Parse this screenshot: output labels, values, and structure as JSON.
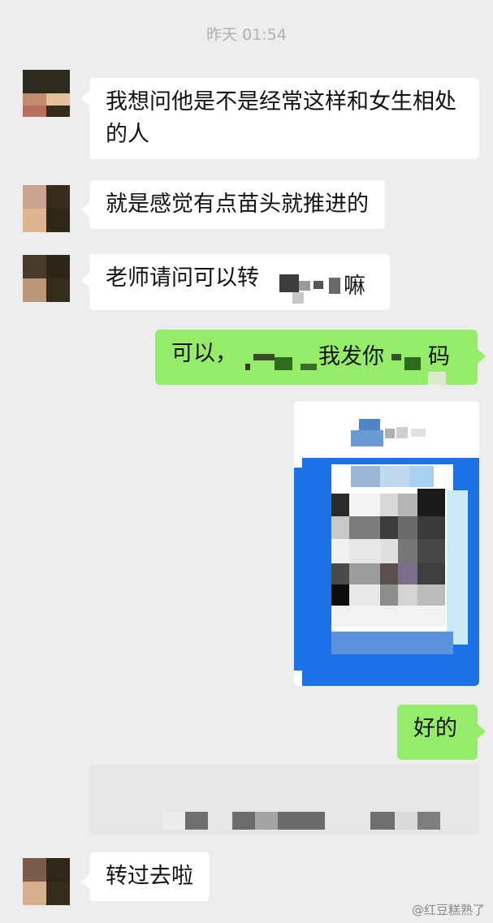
{
  "chat": {
    "timestamp": "昨天 01:54",
    "messages": [
      {
        "side": "in",
        "text": "我想问他是不是经常这样和女生相处的人"
      },
      {
        "side": "in",
        "text": "就是感觉有点苗头就推进的"
      },
      {
        "side": "in",
        "text_before": "老师请问可以转",
        "text_after": "嘛"
      },
      {
        "side": "out",
        "text_before": "可以，",
        "text_mid": "我发你",
        "text_after": "码"
      },
      {
        "side": "out",
        "type": "image",
        "image": "qr-code-pixelated"
      },
      {
        "side": "out",
        "text": "好的"
      },
      {
        "side": "in",
        "type": "card",
        "image": "pixelated-card"
      },
      {
        "side": "in",
        "text": "转过去啦"
      }
    ]
  },
  "watermark": "@红豆糕熟了",
  "colors": {
    "background": "#ededed",
    "incoming_bubble": "#ffffff",
    "outgoing_bubble": "#95ec69"
  }
}
